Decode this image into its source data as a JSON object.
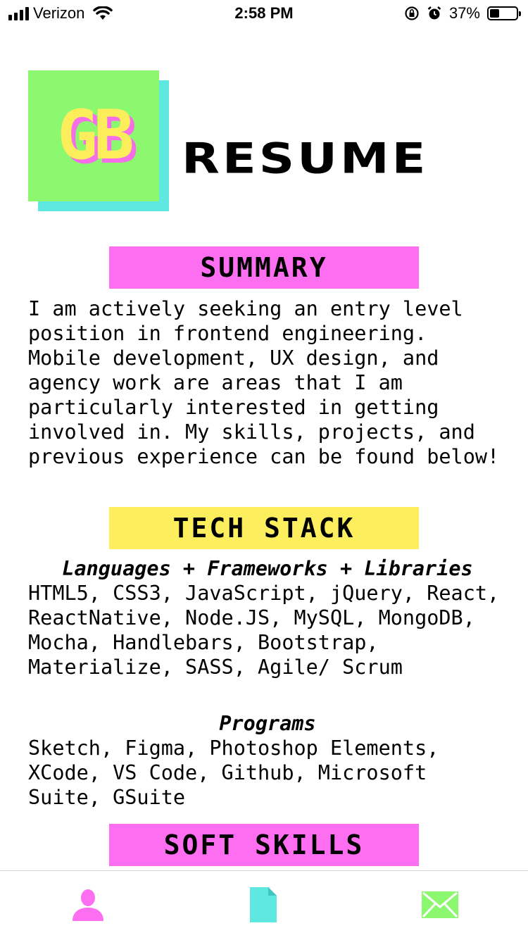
{
  "status_bar": {
    "carrier": "Verizon",
    "time": "2:58 PM",
    "battery_percent": "37%",
    "battery_level": 0.37,
    "icons": [
      "signal-icon",
      "wifi-icon",
      "rotation-lock-icon",
      "alarm-icon",
      "battery-icon"
    ]
  },
  "header": {
    "logo_text": "GB",
    "title": "RESUME"
  },
  "sections": {
    "summary": {
      "title": "SUMMARY",
      "text": "I am actively seeking an entry level position in frontend engineering. Mobile development, UX design, and agency work are areas that I am particularly interested in getting involved in. My skills, projects, and previous experience can be found below!"
    },
    "tech_stack": {
      "title": "TECH STACK",
      "languages_heading": "Languages + Frameworks + Libraries",
      "languages_text": "HTML5, CSS3, JavaScript, jQuery, React, ReactNative, Node.JS, MySQL, MongoDB, Mocha, Handlebars, Bootstrap, Materialize, SASS, Agile/ Scrum",
      "programs_heading": "Programs",
      "programs_text": "Sketch, Figma, Photoshop Elements, XCode, VS Code, Github, Microsoft Suite, GSuite"
    },
    "soft_skills": {
      "title": "SOFT SKILLS"
    }
  },
  "tab_bar": {
    "tabs": [
      {
        "icon": "person-icon",
        "color": "#fd6ff0"
      },
      {
        "icon": "document-icon",
        "color": "#5fe8e0"
      },
      {
        "icon": "envelope-icon",
        "color": "#8cf86f"
      }
    ]
  },
  "colors": {
    "pink": "#fd6ff0",
    "yellow": "#fdee5e",
    "green": "#8cf86f",
    "cyan": "#5fe8e0"
  }
}
